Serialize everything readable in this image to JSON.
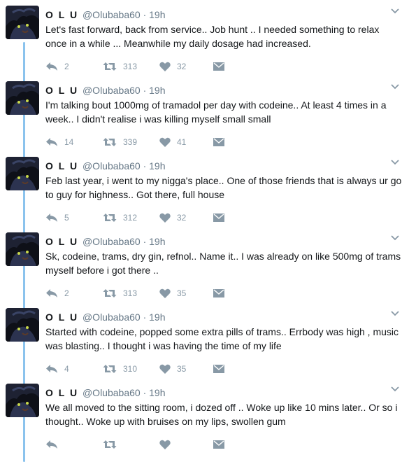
{
  "colors": {
    "thread_line": "#8bc3ed",
    "icon": "#8899a6",
    "secondary_text": "#657786"
  },
  "tweets": [
    {
      "name": "O L U",
      "handle": "@Olubaba60",
      "separator": "·",
      "time": "19h",
      "text": "Let's fast forward, back from service.. Job hunt .. I needed something to relax once in a while ... Meanwhile my daily dosage had increased.",
      "replies": "2",
      "retweets": "313",
      "likes": "32"
    },
    {
      "name": "O L U",
      "handle": "@Olubaba60",
      "separator": "·",
      "time": "19h",
      "text": "I'm talking bout 1000mg of tramadol per day with codeine.. At least 4 times in a week.. I didn't realise i was killing myself small small",
      "replies": "14",
      "retweets": "339",
      "likes": "41"
    },
    {
      "name": "O L U",
      "handle": "@Olubaba60",
      "separator": "·",
      "time": "19h",
      "text": "Feb last year, i went to my nigga's place.. One of those friends that is always ur go to guy for highness.. Got there, full house",
      "replies": "5",
      "retweets": "312",
      "likes": "32"
    },
    {
      "name": "O L U",
      "handle": "@Olubaba60",
      "separator": "·",
      "time": "19h",
      "text": "Sk, codeine, trams, dry gin, refnol.. Name it..  I was already on like 500mg of trams myself before i got there ..",
      "replies": "2",
      "retweets": "313",
      "likes": "35"
    },
    {
      "name": "O L U",
      "handle": "@Olubaba60",
      "separator": "·",
      "time": "19h",
      "text": "Started with codeine, popped some extra pills of trams.. Errbody was high , music was blasting.. I thought i was having the time of my life",
      "replies": "4",
      "retweets": "310",
      "likes": "35"
    },
    {
      "name": "O L U",
      "handle": "@Olubaba60",
      "separator": "·",
      "time": "19h",
      "text": "We all moved to the sitting room, i dozed off .. Woke up like 10 mins later.. Or so i thought.. Woke up with bruises on my lips, swollen gum",
      "replies": "",
      "retweets": "",
      "likes": ""
    }
  ]
}
